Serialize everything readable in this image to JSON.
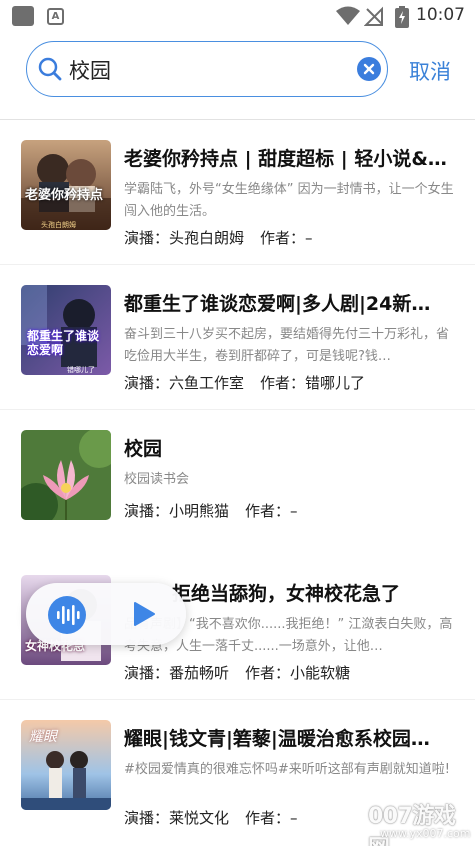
{
  "status_bar": {
    "time": "10:07",
    "app_badge": "A",
    "icons": [
      "notification-square-icon",
      "app-a-icon",
      "wifi-icon",
      "no-signal-icon",
      "battery-charging-icon"
    ]
  },
  "search": {
    "query": "校园",
    "cancel_label": "取消",
    "accent_color": "#3b82d8"
  },
  "results": [
    {
      "title": "老婆你矜持点 | 甜度超标 | 轻小说&…",
      "description": "学霸陆飞，外号“女生绝缘体” 因为一封情书，让一个女生闯入他的生活。",
      "narrator_label": "演播：",
      "narrator": "头孢白朗姆",
      "author_label": "作者：",
      "author": "–",
      "cover_text": "老婆你矜持点",
      "cover_subtext": "头孢白朗姆"
    },
    {
      "title": "都重生了谁谈恋爱啊|多人剧|24新…",
      "description": "奋斗到三十八岁买不起房，要结婚得先付三十万彩礼，省吃俭用大半生，卷到肝都碎了，可是钱呢?钱…",
      "narrator_label": "演播：",
      "narrator": "六鱼工作室",
      "author_label": "作者：",
      "author": "错哪儿了",
      "cover_text": "都重生了谁谈恋爱啊",
      "cover_subtext": "错哪儿了"
    },
    {
      "title": "校园",
      "description": "校园读书会",
      "narrator_label": "演播：",
      "narrator": "小明熊猫",
      "author_label": "作者：",
      "author": "–",
      "cover_text": "",
      "cover_subtext": ""
    },
    {
      "title": "拒绝当舔狗，女神校花急了",
      "description": "品有声剧】“我不喜欢你......我拒绝！” 江潋表白失败，高考失意，人生一落千丈......一场意外，让他…",
      "narrator_label": "演播：",
      "narrator": "番茄畅听",
      "author_label": "作者：",
      "author": "小能软糖",
      "cover_text": "女神校花急",
      "cover_subtext": ""
    },
    {
      "title": "耀眼|钱文青|箬藜|温暖治愈系校园…",
      "description": "#校园爱情真的很难忘怀吗#来听听这部有声剧就知道啦!",
      "narrator_label": "演播：",
      "narrator": "莱悦文化",
      "author_label": "作者：",
      "author": "–",
      "cover_text": "耀眼",
      "cover_subtext": ""
    }
  ],
  "mini_player": {
    "icons": [
      "audio-wave-icon",
      "play-icon"
    ],
    "accent_color": "#3e86e6"
  },
  "watermark": {
    "logo": "007游戏网",
    "url": "www.yx007.com"
  }
}
